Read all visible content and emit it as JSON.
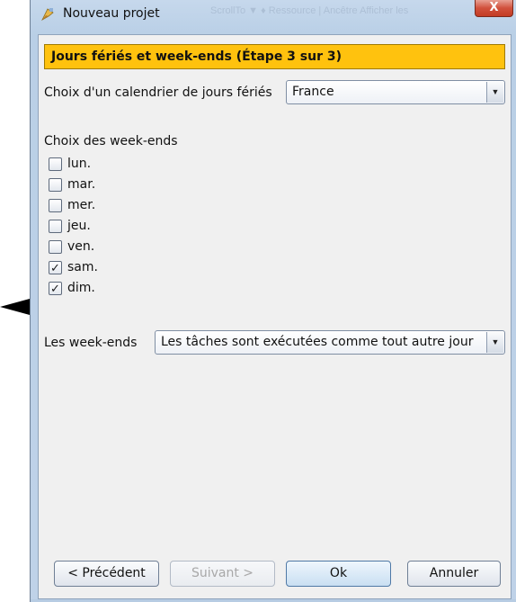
{
  "window": {
    "title": "Nouveau projet",
    "close_label": "X",
    "background_titles": "ScrollTo  ▼  ♦  Ressource  |  Ancêtre     Afficher les"
  },
  "step": {
    "banner": "Jours fériés et week-ends (Étape 3 sur 3)"
  },
  "holiday_calendar": {
    "label": "Choix d'un calendrier de jours fériés",
    "value": "France"
  },
  "weekends_section": {
    "title": "Choix des week-ends",
    "days": [
      {
        "label": "lun.",
        "checked": false
      },
      {
        "label": "mar.",
        "checked": false
      },
      {
        "label": "mer.",
        "checked": false
      },
      {
        "label": "jeu.",
        "checked": false
      },
      {
        "label": "ven.",
        "checked": false
      },
      {
        "label": "sam.",
        "checked": true
      },
      {
        "label": "dim.",
        "checked": true
      }
    ]
  },
  "weekend_policy": {
    "label": "Les week-ends",
    "value": "Les tâches sont exécutées comme tout autre jour"
  },
  "buttons": {
    "previous": "< Précédent",
    "next": "Suivant >",
    "ok": "Ok",
    "cancel": "Annuler"
  },
  "colors": {
    "banner": "#ffc20e",
    "window_frame": "#c6d8ec",
    "close": "#c33b24"
  }
}
